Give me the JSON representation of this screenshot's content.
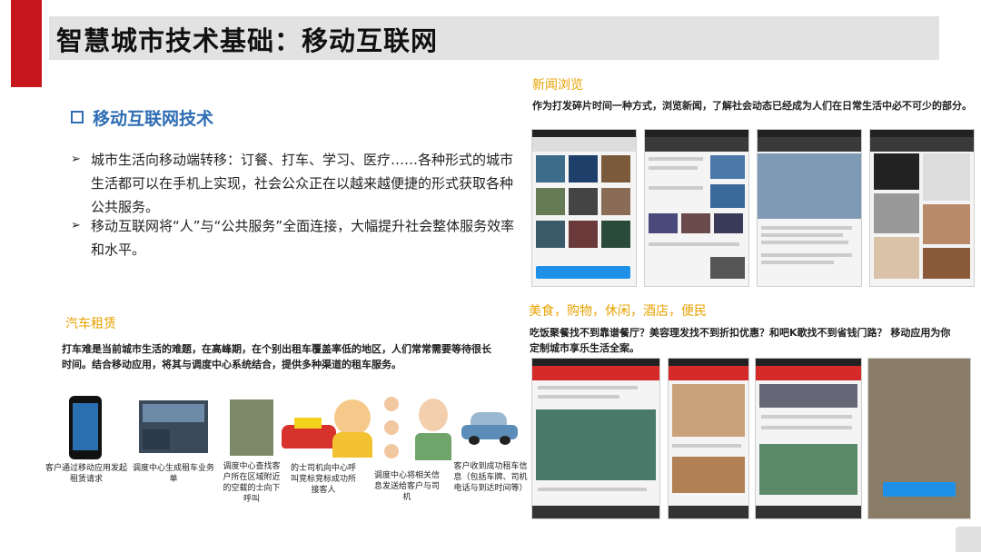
{
  "slide": {
    "title": "智慧城市技术基础：移动互联网",
    "section_heading": "移动互联网技术",
    "bullets": [
      "城市生活向移动端转移：订餐、打车、学习、医疗……各种形式的城市生活都可以在手机上实现，社会公众正在以越来越便捷的形式获取各种公共服务。",
      "移动互联网将“人”与“公共服务”全面连接，大幅提升社会整体服务效率和水平。"
    ]
  },
  "news": {
    "heading": "新闻浏览",
    "description": "作为打发碎片时间一种方式，浏览新闻，了解社会动态已经成为人们在日常生活中必不可少的部分。"
  },
  "food": {
    "heading": "美食，购物，休闲，酒店，便民",
    "description": "吃饭聚餐找不到靠谱餐厅？美容理发找不到折扣优惠？和吧K歌找不到省钱门路？ 移动应用为你定制城市享乐生活全案。"
  },
  "car": {
    "heading": "汽车租赁",
    "description": "打车难是当前城市生活的难题，在高峰期，在个别出租车覆盖率低的地区，人们常常需要等待很长时间。结合移动应用，将其与调度中心系统结合，提供多种渠道的租车服务。",
    "steps": [
      "客户通过移动应用发起租赁请求",
      "调度中心生成租车业务单",
      "调度中心查找客户所在区域附近的空载的士向下呼叫",
      "的士司机向中心呼叫竞标竞标成功所接客人",
      "调度中心将相关信息发送给客户与司机",
      "客户收到成功租车信息（包括车牌、司机电话与到达时间等）"
    ]
  },
  "colors": {
    "accent_red": "#c8161d",
    "heading_blue": "#2e6db4",
    "sub_orange": "#e8a200"
  }
}
